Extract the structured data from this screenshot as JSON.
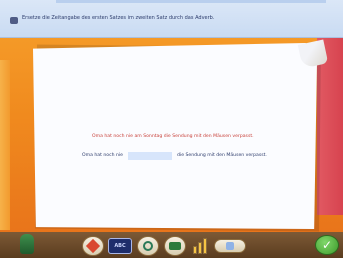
{
  "instruction": "Ersetze die Zeitangabe des ersten Satzes im zweiten Satz durch das Adverb.",
  "exercise": {
    "example_sentence": "Oma hat noch nie am Sonntag die Sendung mit den Mäusen verpasst.",
    "sentence_before": "Oma hat noch nie",
    "answer_value": "",
    "sentence_after": "die Sendung mit den Mäusen verpasst."
  },
  "toolbar": {
    "items": [
      {
        "icon": "character-figure-icon"
      },
      {
        "icon": "eraser-icon"
      },
      {
        "icon": "notebook-icon",
        "label": "ABC"
      },
      {
        "icon": "help-icon"
      },
      {
        "icon": "camera-icon"
      },
      {
        "icon": "stats-bars-icon"
      },
      {
        "icon": "keyboard-icon"
      },
      {
        "icon": "check-icon"
      }
    ]
  },
  "colors": {
    "background": "#f08a1e",
    "top_bar": "#d6e4f6",
    "example_text": "#c8413a",
    "body_text": "#2c3b6b",
    "input_fill": "#d7e5fb",
    "check_button": "#4caf37"
  }
}
